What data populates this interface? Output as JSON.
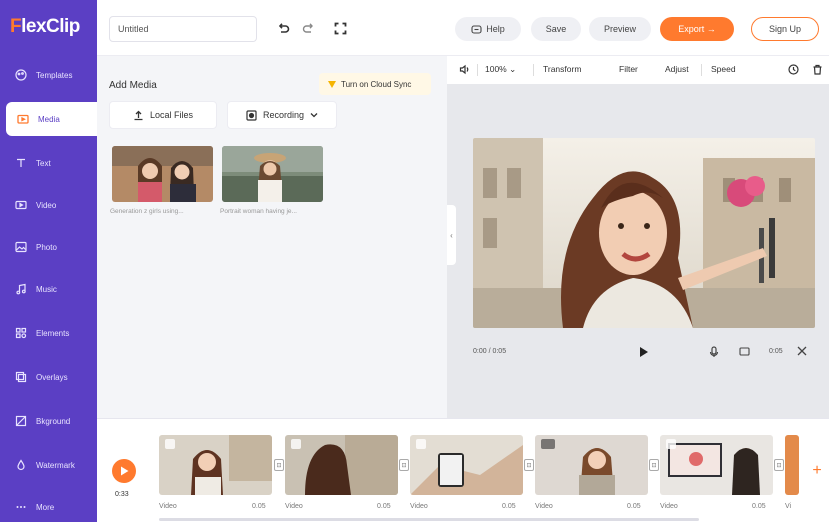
{
  "app": {
    "logo_f": "F",
    "logo_rest": "lexClip"
  },
  "sidebar": {
    "items": [
      {
        "label": "Templates",
        "icon": "palette-icon"
      },
      {
        "label": "Media",
        "icon": "folder-icon",
        "active": true
      },
      {
        "label": "Text",
        "icon": "text-icon"
      },
      {
        "label": "Video",
        "icon": "video-icon"
      },
      {
        "label": "Photo",
        "icon": "photo-icon"
      },
      {
        "label": "Music",
        "icon": "music-icon"
      },
      {
        "label": "Elements",
        "icon": "elements-icon"
      },
      {
        "label": "Overlays",
        "icon": "overlay-icon"
      },
      {
        "label": "Bkground",
        "icon": "background-icon"
      },
      {
        "label": "Watermark",
        "icon": "watermark-icon"
      },
      {
        "label": "More",
        "icon": "more-icon"
      }
    ]
  },
  "topbar": {
    "title_value": "Untitled",
    "help": "Help",
    "save": "Save",
    "preview": "Preview",
    "export": "Export →",
    "signup": "Sign Up"
  },
  "media": {
    "heading": "Add Media",
    "gdrive": "Turn on Cloud Sync",
    "local_files": "Local Files",
    "recording": "Recording",
    "items": [
      {
        "caption": "Generation z girls using..."
      },
      {
        "caption": "Portrait woman having je..."
      }
    ]
  },
  "preview": {
    "zoom": "100%",
    "transform": "Transform",
    "filter": "Filter",
    "adjust": "Adjust",
    "speed": "Speed",
    "time": "0:00 / 0:05",
    "duration": "0:05"
  },
  "timeline": {
    "time": "0:33",
    "clips": [
      {
        "label": "Video",
        "dur": "0.05"
      },
      {
        "label": "Video",
        "dur": "0.05"
      },
      {
        "label": "Video",
        "dur": "0.05"
      },
      {
        "label": "Video",
        "dur": "0.05"
      },
      {
        "label": "Video",
        "dur": "0.05"
      },
      {
        "label": "Vi",
        "dur": ""
      }
    ]
  },
  "colors": {
    "brand": "#5b3fc4",
    "accent": "#ff7a2e"
  }
}
